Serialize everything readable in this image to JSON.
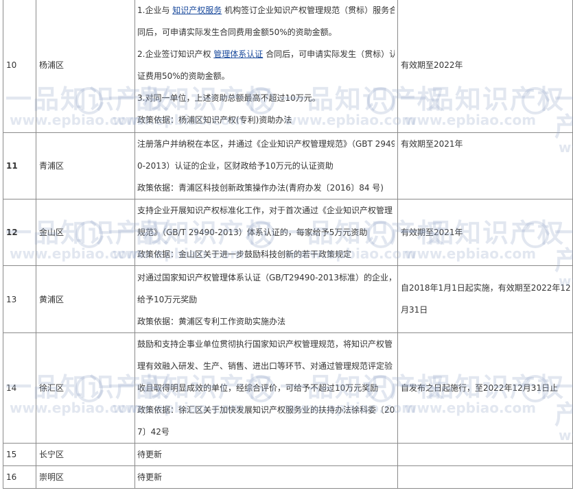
{
  "rows": [
    {
      "no": "10",
      "district": "杨浦区",
      "desc": [
        {
          "parts": [
            {
              "t": "1.企业与 "
            },
            {
              "t": "知识产权服务",
              "link": true
            },
            {
              "t": " 机构签订企业知识产权管理规范（贯标）服务合"
            }
          ]
        },
        {
          "parts": [
            {
              "t": "同后，可申请实际发生合同费用金额50%的资助金额。"
            }
          ]
        },
        {
          "parts": [
            {
              "t": "2.企业签订知识产权 "
            },
            {
              "t": "管理体系认证",
              "link": true
            },
            {
              "t": " 合同后，可申请实际发生（贯标）认"
            }
          ]
        },
        {
          "parts": [
            {
              "t": "证费用50%的资助金额。"
            }
          ]
        },
        {
          "parts": [
            {
              "t": "3.对同一单位，上述资助总额最高不超过10万元。"
            }
          ]
        },
        {
          "parts": [
            {
              "t": "政策依据：杨浦区知识产权(专利)资助办法"
            }
          ]
        }
      ],
      "validity": "有效期至2022年"
    },
    {
      "no": "11",
      "bold": true,
      "district": "青浦区",
      "desc": [
        {
          "parts": [
            {
              "t": "注册落户并纳税在本区，并通过《企业知识产权管理规范》（GBT 2949"
            }
          ]
        },
        {
          "parts": [
            {
              "t": "0-2013）认证的企业，区财政给予10万元的认证资助"
            }
          ]
        },
        {
          "parts": [
            {
              "t": "政策依据：青浦区科技创新政策操作办法(青府办发〔2016〕84 号)"
            }
          ]
        }
      ],
      "validity": "有效期至2021年",
      "validity_top": true
    },
    {
      "no": "12",
      "bold": true,
      "district": "金山区",
      "desc": [
        {
          "parts": [
            {
              "t": "支持企业开展知识产权标准化工作，对于首次通过《企业知识产权管理"
            }
          ]
        },
        {
          "parts": [
            {
              "t": "规范》（GB/T 29490-2013）体系认证的，每家给予5万元资助"
            }
          ]
        },
        {
          "parts": [
            {
              "t": "政策依据：金山区关于进一步鼓励科技创新的若干政策规定"
            }
          ]
        }
      ],
      "validity": "有效期至2021年"
    },
    {
      "no": "13",
      "district": "黄浦区",
      "desc": [
        {
          "parts": [
            {
              "t": "对通过国家知识产权管理体系认证（GB/T29490-2013标准）的企业，"
            }
          ]
        },
        {
          "parts": [
            {
              "t": "给予10万元奖励"
            }
          ]
        },
        {
          "parts": [
            {
              "t": "政策依据：黄浦区专利工作资助实施办法"
            }
          ]
        }
      ],
      "validity_lines": [
        "自2018年1月1日起实施，有效期至2022年12",
        "月31日"
      ]
    },
    {
      "no": "14",
      "district": "徐汇区",
      "desc": [
        {
          "parts": [
            {
              "t": "鼓励和支持企事业单位贯彻执行国家知识产权管理规范，将知识产权管"
            }
          ]
        },
        {
          "parts": [
            {
              "t": "理有效融入研发、生产、销售、进出口等环节、对通过管理规范评定验"
            }
          ]
        },
        {
          "parts": [
            {
              "t": "收且取得明显成效的单位，经综合评价，可给予不超过10万元奖励"
            }
          ]
        },
        {
          "parts": [
            {
              "t": "政策依据：徐汇区关于加快发展知识产权服务业的扶持办法徐科委〔201"
            }
          ]
        },
        {
          "parts": [
            {
              "t": "7〕42号"
            }
          ]
        }
      ],
      "validity": "自发布之日起施行，至2022年12月31日止"
    },
    {
      "no": "15",
      "district": "长宁区",
      "desc": [
        {
          "parts": [
            {
              "t": "待更新"
            }
          ]
        }
      ],
      "validity": ""
    },
    {
      "no": "16",
      "district": "崇明区",
      "desc": [
        {
          "parts": [
            {
              "t": "待更新"
            }
          ]
        }
      ],
      "validity": ""
    }
  ],
  "watermark": {
    "text": "一品知识产权",
    "url": "www.epbiao.com"
  },
  "colors": {
    "link": "#1a4a9c",
    "border": "#8a8a8a",
    "watermark": "#96aac8"
  }
}
